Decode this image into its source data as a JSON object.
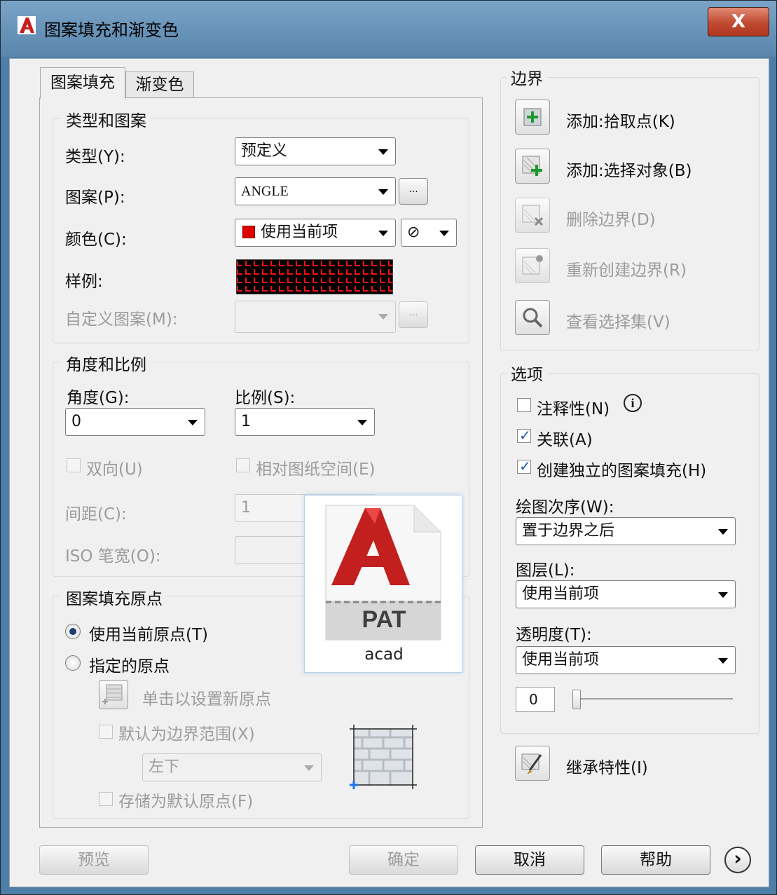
{
  "window": {
    "title": "图案填充和渐变色",
    "close_label": "X"
  },
  "tabs": [
    {
      "label": "图案填充"
    },
    {
      "label": "渐变色"
    }
  ],
  "type_pattern": {
    "group_label": "类型和图案",
    "type_label": "类型(Y):",
    "type_value": "预定义",
    "pattern_label": "图案(P):",
    "pattern_value": "ANGLE",
    "browse_label": "...",
    "color_label": "颜色(C):",
    "color_value": "使用当前项",
    "color_swatch": "#e00000",
    "bgcolor_glyph": "⊘",
    "sample_label": "样例:",
    "custom_label": "自定义图案(M):",
    "custom_value": ""
  },
  "angle_scale": {
    "group_label": "角度和比例",
    "angle_label": "角度(G):",
    "angle_value": "0",
    "scale_label": "比例(S):",
    "scale_value": "1",
    "double_label": "双向(U)",
    "relative_label": "相对图纸空间(E)",
    "spacing_label": "间距(C):",
    "spacing_value": "1",
    "iso_label": "ISO 笔宽(O):",
    "iso_value": ""
  },
  "origin": {
    "group_label": "图案填充原点",
    "current_label": "使用当前原点(T)",
    "specified_label": "指定的原点",
    "click_set_label": "单击以设置新原点",
    "default_extents_label": "默认为边界范围(X)",
    "position_value": "左下",
    "store_label": "存储为默认原点(F)"
  },
  "tooltip": {
    "file_type": "PAT",
    "file_name": "acad"
  },
  "boundaries": {
    "group_label": "边界",
    "add_pick": "添加:拾取点(K)",
    "add_select": "添加:选择对象(B)",
    "remove": "删除边界(D)",
    "recreate": "重新创建边界(R)",
    "view": "查看选择集(V)"
  },
  "options": {
    "group_label": "选项",
    "annotative_label": "注释性(N)",
    "info_glyph": "i",
    "associative_label": "关联(A)",
    "separate_label": "创建独立的图案填充(H)",
    "draw_order_label": "绘图次序(W):",
    "draw_order_value": "置于边界之后",
    "layer_label": "图层(L):",
    "layer_value": "使用当前项",
    "transparency_label": "透明度(T):",
    "transparency_value": "使用当前项",
    "transparency_amount": "0"
  },
  "inherit_label": "继承特性(I)",
  "footer": {
    "preview": "预览",
    "ok": "确定",
    "cancel": "取消",
    "help": "帮助",
    "more_glyph": "›"
  }
}
